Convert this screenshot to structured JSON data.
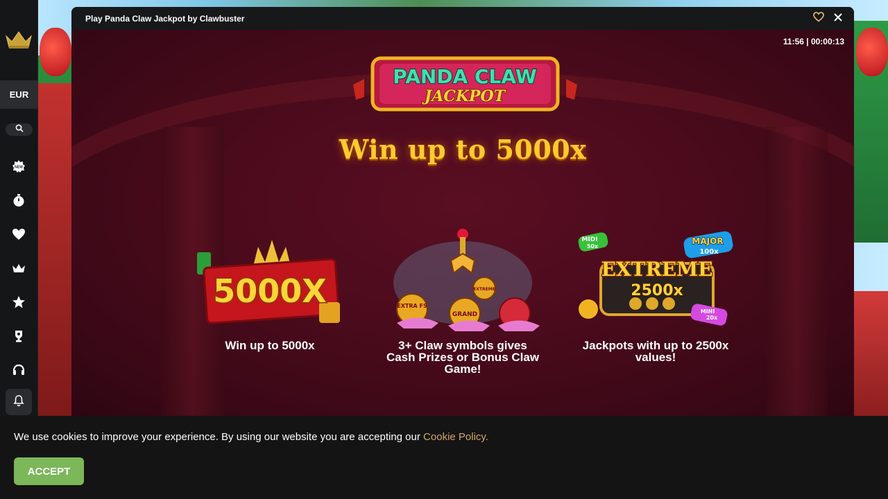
{
  "modal": {
    "title": "Play Panda Claw Jackpot by Clawbuster",
    "clock": "11:56 | 00:00:13"
  },
  "sidebar": {
    "currency": "EUR",
    "icons": [
      "crown-logo-icon",
      "search-icon",
      "new-badge-icon",
      "stopwatch-icon",
      "heart-icon",
      "crown-icon",
      "star-icon",
      "trophy-icon",
      "headset-icon",
      "bell-icon"
    ]
  },
  "game": {
    "logo_line1": "PANDA CLAW",
    "logo_line2": "JACKPOT",
    "headline": "Win up to 5000x",
    "features": [
      {
        "art_text": "5000X",
        "caption": "Win up to 5000x"
      },
      {
        "art_badges": [
          "EXTRA FS",
          "GRAND",
          "EXTREME"
        ],
        "caption": "3+ Claw symbols gives Cash Prizes or Bonus Claw Game!"
      },
      {
        "art_text": "EXTREME",
        "art_value": "2500x",
        "art_badges": [
          "MIDI",
          "50x",
          "MAJOR",
          "100x",
          "MINI",
          "20x"
        ],
        "caption": "Jackpots with up to 2500x values!"
      }
    ]
  },
  "cookie": {
    "text": "We use cookies to improve your experience. By using our website you are accepting our ",
    "link": "Cookie Policy.",
    "accept_label": "ACCEPT"
  },
  "colors": {
    "accent_gold": "#ffcb2e",
    "accept_green": "#7cb75a",
    "link_tan": "#d3a46a",
    "game_bg": "#4a0b1c"
  }
}
